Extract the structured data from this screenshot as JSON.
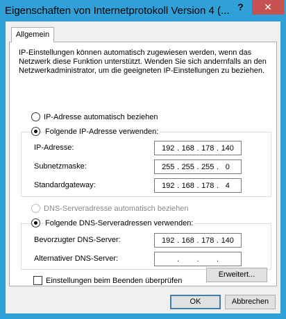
{
  "window": {
    "title": "Eigenschaften von Internetprotokoll Version 4 (...",
    "help_label": "?",
    "close_label": "✕"
  },
  "tabs": [
    {
      "label": "Allgemein"
    }
  ],
  "intro_text": "IP-Einstellungen können automatisch zugewiesen werden, wenn das Netzwerk diese Funktion unterstützt. Wenden Sie sich andernfalls an den Netzwerkadministrator, um die geeigneten IP-Einstellungen zu beziehen.",
  "ip": {
    "auto_label": "IP-Adresse automatisch beziehen",
    "manual_label": "Folgende IP-Adresse verwenden:",
    "selected": "manual",
    "address": {
      "label": "IP-Adresse:",
      "octets": [
        "192",
        "168",
        "178",
        "140"
      ]
    },
    "subnet": {
      "label": "Subnetzmaske:",
      "octets": [
        "255",
        "255",
        "255",
        "0"
      ]
    },
    "gateway": {
      "label": "Standardgateway:",
      "octets": [
        "192",
        "168",
        "178",
        "4"
      ]
    }
  },
  "dns": {
    "auto_label": "DNS-Serveradresse automatisch beziehen",
    "manual_label": "Folgende DNS-Serveradressen verwenden:",
    "selected": "manual",
    "preferred": {
      "label": "Bevorzugter DNS-Server:",
      "octets": [
        "192",
        "168",
        "178",
        "140"
      ]
    },
    "alternate": {
      "label": "Alternativer DNS-Server:",
      "octets": [
        "",
        "",
        "",
        ""
      ]
    }
  },
  "validate_on_exit": {
    "label": "Einstellungen beim Beenden überprüfen",
    "checked": false
  },
  "buttons": {
    "advanced": "Erweitert...",
    "ok": "OK",
    "cancel": "Abbrechen"
  },
  "colors": {
    "titlebar": "#2fa0d8",
    "close_button": "#c75050",
    "dialog_bg": "#f0f0f0"
  }
}
